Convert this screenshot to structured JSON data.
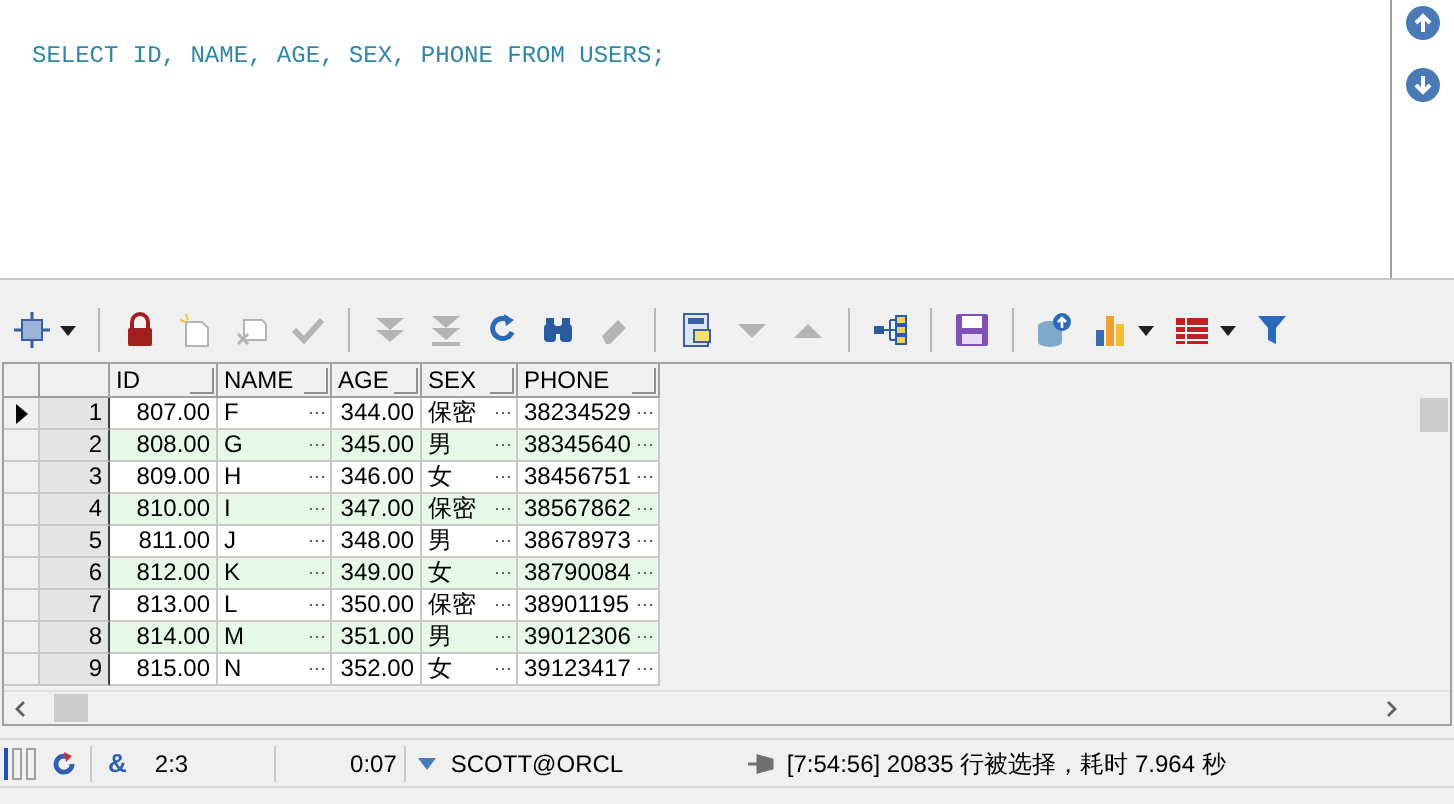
{
  "editor": {
    "sql": "SELECT ID, NAME, AGE, SEX, PHONE FROM USERS;"
  },
  "toolbar": [
    {
      "kind": "grid-select",
      "disabled": false,
      "dropdown": true
    },
    {
      "kind": "sep"
    },
    {
      "kind": "lock",
      "disabled": false,
      "dropdown": false
    },
    {
      "kind": "new-record",
      "disabled": true,
      "dropdown": false
    },
    {
      "kind": "delete-record",
      "disabled": true,
      "dropdown": false
    },
    {
      "kind": "check",
      "disabled": true,
      "dropdown": false
    },
    {
      "kind": "sep"
    },
    {
      "kind": "double-down",
      "disabled": true,
      "dropdown": false
    },
    {
      "kind": "last",
      "disabled": true,
      "dropdown": false
    },
    {
      "kind": "refresh",
      "disabled": false,
      "dropdown": false
    },
    {
      "kind": "binoculars",
      "disabled": false,
      "dropdown": false
    },
    {
      "kind": "eraser",
      "disabled": true,
      "dropdown": false
    },
    {
      "kind": "sep"
    },
    {
      "kind": "form",
      "disabled": false,
      "dropdown": false
    },
    {
      "kind": "triangle-down",
      "disabled": true,
      "dropdown": false
    },
    {
      "kind": "triangle-up",
      "disabled": true,
      "dropdown": false
    },
    {
      "kind": "sep"
    },
    {
      "kind": "tree",
      "disabled": false,
      "dropdown": false
    },
    {
      "kind": "sep"
    },
    {
      "kind": "save",
      "disabled": false,
      "dropdown": false
    },
    {
      "kind": "sep"
    },
    {
      "kind": "database",
      "disabled": false,
      "dropdown": false
    },
    {
      "kind": "bar-chart",
      "disabled": false,
      "dropdown": true
    },
    {
      "kind": "table",
      "disabled": false,
      "dropdown": true
    },
    {
      "kind": "filter",
      "disabled": false,
      "dropdown": false
    }
  ],
  "grid": {
    "columns": [
      "ID",
      "NAME",
      "AGE",
      "SEX",
      "PHONE"
    ],
    "rows": [
      {
        "num": "1",
        "cells": [
          "807.00",
          "F",
          "344.00",
          "保密",
          "38234529"
        ],
        "selected": true
      },
      {
        "num": "2",
        "cells": [
          "808.00",
          "G",
          "345.00",
          "男",
          "38345640"
        ],
        "selected": false
      },
      {
        "num": "3",
        "cells": [
          "809.00",
          "H",
          "346.00",
          "女",
          "38456751"
        ],
        "selected": false
      },
      {
        "num": "4",
        "cells": [
          "810.00",
          "I",
          "347.00",
          "保密",
          "38567862"
        ],
        "selected": false
      },
      {
        "num": "5",
        "cells": [
          "811.00",
          "J",
          "348.00",
          "男",
          "38678973"
        ],
        "selected": false
      },
      {
        "num": "6",
        "cells": [
          "812.00",
          "K",
          "349.00",
          "女",
          "38790084"
        ],
        "selected": false
      },
      {
        "num": "7",
        "cells": [
          "813.00",
          "L",
          "350.00",
          "保密",
          "38901195"
        ],
        "selected": false
      },
      {
        "num": "8",
        "cells": [
          "814.00",
          "M",
          "351.00",
          "男",
          "39012306"
        ],
        "selected": false
      },
      {
        "num": "9",
        "cells": [
          "815.00",
          "N",
          "352.00",
          "女",
          "39123417"
        ],
        "selected": false
      }
    ]
  },
  "status_bar": {
    "symbol": "&",
    "position": "2:3",
    "elapsed": "0:07",
    "connection": "SCOTT@ORCL",
    "message": "[7:54:56] 20835 行被选择，耗时 7.964 秒"
  }
}
